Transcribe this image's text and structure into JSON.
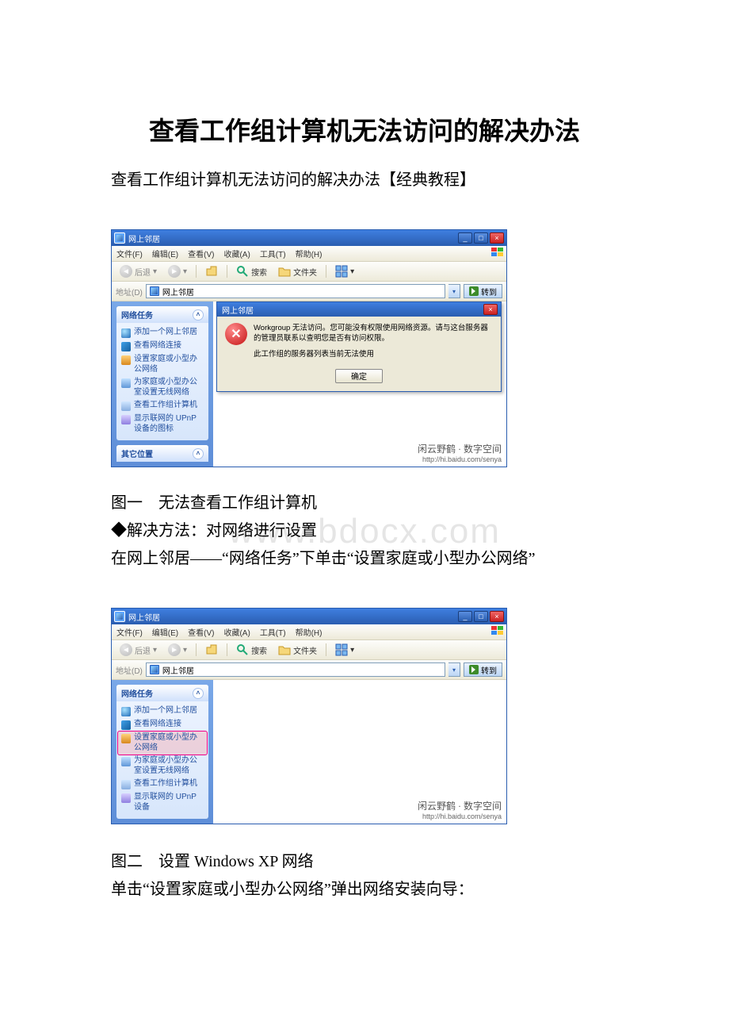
{
  "doc": {
    "title": "查看工作组计算机无法访问的解决办法",
    "subtitle": "查看工作组计算机无法访问的解决办法【经典教程】",
    "caption1": "图一 无法查看工作组计算机",
    "solution_label": "◆解决方法：对网络进行设置",
    "step1": "在网上邻居——“网络任务”下单击“设置家庭或小型办公网络”",
    "caption2": "图二 设置 Windows XP 网络",
    "step2": "单击“设置家庭或小型办公网络”弹出网络安装向导：",
    "watermark": "www.bdocx.com"
  },
  "xp": {
    "window_title": "网上邻居",
    "menus": {
      "file": "文件(F)",
      "edit": "编辑(E)",
      "view": "查看(V)",
      "fav": "收藏(A)",
      "tools": "工具(T)",
      "help": "帮助(H)"
    },
    "toolbar": {
      "back": "后退",
      "search": "搜索",
      "folders": "文件夹"
    },
    "addr": {
      "label": "地址(D)",
      "value": "网上邻居",
      "go": "转到"
    },
    "tasks_header": "网络任务",
    "other_header": "其它位置",
    "tasks1": {
      "t0": "添加一个网上邻居",
      "t1": "查看网络连接",
      "t2": "设置家庭或小型办公网络",
      "t3": "为家庭或小型办公室设置无线网络",
      "t4": "查看工作组计算机",
      "t5": "显示联网的 UPnP 设备的图标"
    },
    "tasks2": {
      "t0": "添加一个网上邻居",
      "t1": "查看网络连接",
      "t2": "设置家庭或小型办公网络",
      "t3": "为家庭或小型办公室设置无线网络",
      "t4": "查看工作组计算机",
      "t5": "显示联网的 UPnP 设备"
    },
    "dialog": {
      "title": "网上邻居",
      "line1": "Workgroup 无法访问。您可能没有权限使用网络资源。请与这台服务器的管理员联系以查明您是否有访问权限。",
      "line2": "此工作组的服务器列表当前无法使用",
      "ok": "确定"
    },
    "sig_cn": "闲云野鹤 · 数字空间",
    "sig_url": "http://hi.baidu.com/senya"
  }
}
